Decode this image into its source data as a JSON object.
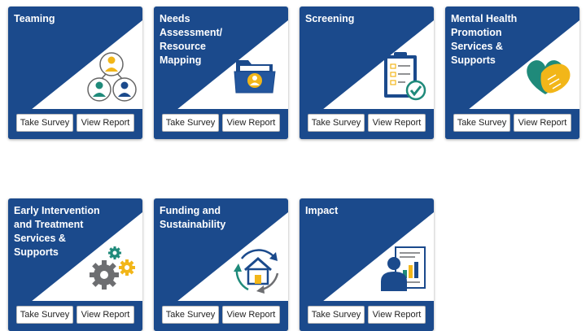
{
  "cards": [
    {
      "title": "Teaming",
      "icon": "team-hierarchy-icon",
      "take": "Take Survey",
      "view": "View Report"
    },
    {
      "title": "Needs Assessment/ Resource Mapping",
      "icon": "folder-person-icon",
      "take": "Take Survey",
      "view": "View Report"
    },
    {
      "title": "Screening",
      "icon": "clipboard-check-icon",
      "take": "Take Survey",
      "view": "View Report"
    },
    {
      "title": "Mental Health Promotion Services & Supports",
      "icon": "heart-hands-icon",
      "take": "Take Survey",
      "view": "View Report"
    },
    {
      "title": "Early Intervention and Treatment Services & Supports",
      "icon": "gears-icon",
      "take": "Take Survey",
      "view": "View Report"
    },
    {
      "title": "Funding and Sustainability",
      "icon": "house-cycle-icon",
      "take": "Take Survey",
      "view": "View Report"
    },
    {
      "title": "Impact",
      "icon": "person-report-icon",
      "take": "Take Survey",
      "view": "View Report"
    }
  ],
  "colors": {
    "card": "#1b4a8c",
    "gold": "#f2b619",
    "teal": "#1f8a7a",
    "gray": "#6d6e71"
  }
}
